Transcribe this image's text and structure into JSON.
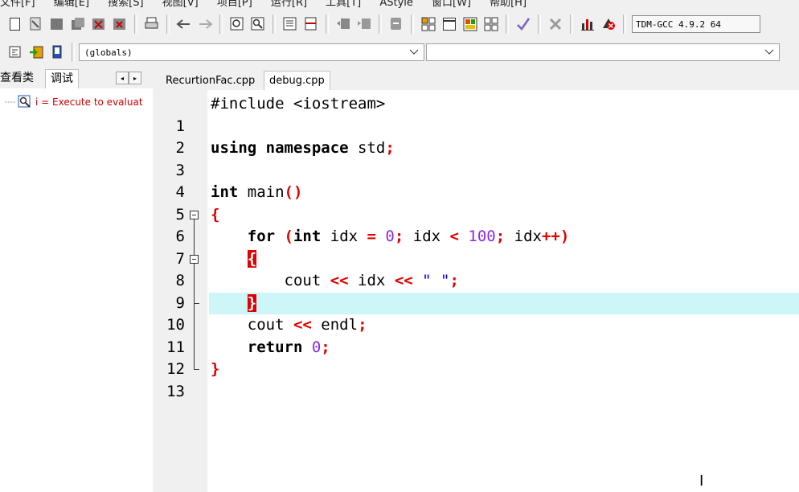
{
  "menu": [
    "文件[F]",
    "编辑[E]",
    "搜索[S]",
    "视图[V]",
    "项目[P]",
    "运行[R]",
    "工具[T]",
    "AStyle",
    "窗口[W]",
    "帮助[H]"
  ],
  "toolbar": {
    "icons": [
      "new-file-icon",
      "open-file-icon",
      "save-icon",
      "save-all-icon",
      "close-icon",
      "close-all-icon",
      "print-icon",
      "undo-icon",
      "redo-icon",
      "find-icon",
      "replace-icon",
      "goto-icon",
      "toggle-icon",
      "indent-icon",
      "unindent-icon",
      "toggle-comment-icon",
      "new-project-icon",
      "project-options-icon",
      "layout-icon",
      "grid-icon",
      "check-syntax-icon",
      "stop-icon",
      "chart-icon",
      "debug-stop-icon"
    ],
    "compiler": "TDM-GCC 4.9.2 64"
  },
  "toolbar2": {
    "class_combo": "(globals)",
    "member_combo": ""
  },
  "left_panel": {
    "tabs": [
      "查看类",
      "调试"
    ],
    "active_tab": "调试",
    "watch_item": "i = Execute to evaluat"
  },
  "editor_tabs": [
    "RecurtionFac.cpp",
    "debug.cpp"
  ],
  "active_editor_tab": "debug.cpp",
  "code_lines": [
    {
      "n": "1"
    },
    {
      "n": "2"
    },
    {
      "n": "3"
    },
    {
      "n": "4"
    },
    {
      "n": "5"
    },
    {
      "n": "6"
    },
    {
      "n": "7"
    },
    {
      "n": "8"
    },
    {
      "n": "9"
    },
    {
      "n": "10"
    },
    {
      "n": "11"
    },
    {
      "n": "12"
    },
    {
      "n": "13"
    }
  ],
  "code": {
    "l1_a": "#include <iostream>",
    "l3_kw": "using namespace",
    "l3_id": " std",
    "l3_op": ";",
    "l5_kw": "int",
    "l5_id": " main",
    "l5_op": "()",
    "l6": "{",
    "l7_kw1": "for",
    "l7_op1": " (",
    "l7_kw2": "int",
    "l7_id1": " idx ",
    "l7_op2": "=",
    "l7_num1": " 0",
    "l7_op3": ";",
    "l7_id2": " idx ",
    "l7_op4": "<",
    "l7_num2": " 100",
    "l7_op5": ";",
    "l7_id3": " idx",
    "l7_op6": "++)",
    "l8": "{",
    "l9_id1": "cout ",
    "l9_op1": "<<",
    "l9_id2": " idx ",
    "l9_op2": "<<",
    "l9_str": " \" \"",
    "l9_op3": ";",
    "l10": "}",
    "l11_id1": "cout ",
    "l11_op1": "<<",
    "l11_id2": " endl",
    "l11_op2": ";",
    "l12_kw": "return",
    "l12_num": " 0",
    "l12_op": ";",
    "l13": "}"
  },
  "colors": {
    "keyword": "#000000",
    "operator": "#e00000",
    "number": "#8a2be2",
    "string": "#0000ff",
    "highlight_line": "#cdf6f8",
    "brace_match": "#e00000"
  }
}
